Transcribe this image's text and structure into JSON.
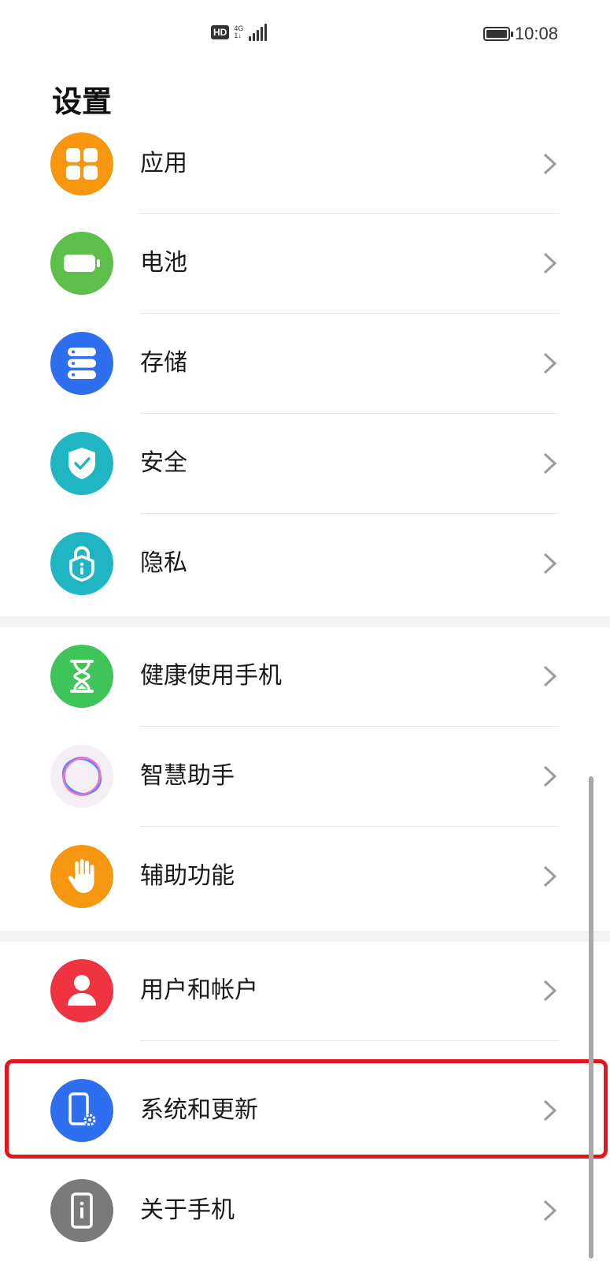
{
  "status_bar": {
    "hd_label": "HD",
    "network_label_top": "4G",
    "network_label_bottom": "1↓",
    "time": "10:08"
  },
  "page": {
    "title": "设置"
  },
  "settings": {
    "apps": {
      "label": "应用",
      "color": "#f7960f"
    },
    "battery": {
      "label": "电池",
      "color": "#5cc04a"
    },
    "storage": {
      "label": "存储",
      "color": "#2e6ff0"
    },
    "security": {
      "label": "安全",
      "color": "#1fb5c2"
    },
    "privacy": {
      "label": "隐私",
      "color": "#1fb5c2"
    },
    "digital_balance": {
      "label": "健康使用手机",
      "color": "#3fc45a"
    },
    "assistant": {
      "label": "智慧助手",
      "color": "#f5eef5"
    },
    "accessibility": {
      "label": "辅助功能",
      "color": "#f7960f"
    },
    "users": {
      "label": "用户和帐户",
      "color": "#ef3340"
    },
    "system": {
      "label": "系统和更新",
      "color": "#2e6ff0"
    },
    "about": {
      "label": "关于手机",
      "color": "#7a7a7a"
    }
  },
  "highlight": {
    "target": "system",
    "color": "#e8141b"
  }
}
